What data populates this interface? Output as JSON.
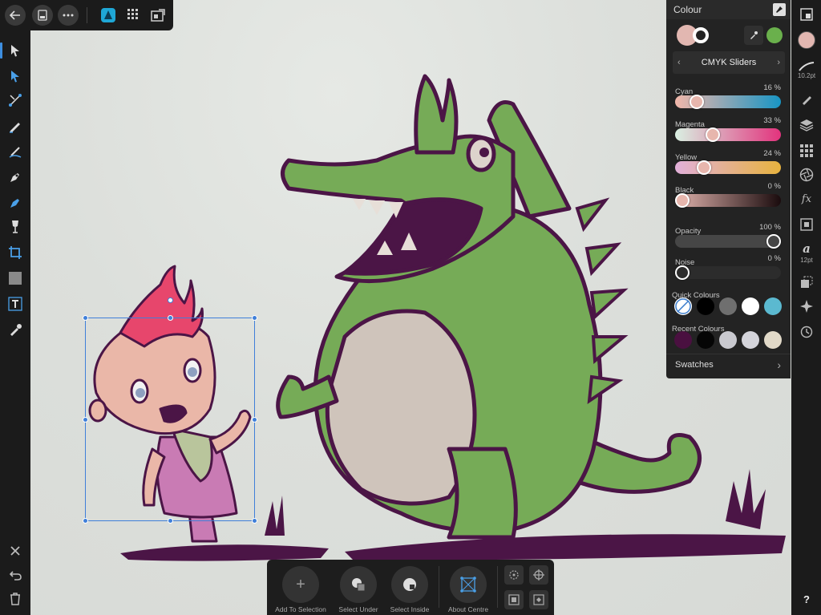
{
  "colour_panel": {
    "title": "Colour",
    "mode": "CMYK Sliders",
    "cyan": {
      "label": "Cyan",
      "value": "16 %",
      "fraction": 0.16
    },
    "magenta": {
      "label": "Magenta",
      "value": "33 %",
      "fraction": 0.33
    },
    "yellow": {
      "label": "Yellow",
      "value": "24 %",
      "fraction": 0.24
    },
    "black": {
      "label": "Black",
      "value": "0 %",
      "fraction": 0.0
    },
    "opacity": {
      "label": "Opacity",
      "value": "100 %",
      "fraction": 1.0
    },
    "noise": {
      "label": "Noise",
      "value": "0 %",
      "fraction": 0.0
    },
    "quick_colours_label": "Quick Colours",
    "recent_colours_label": "Recent Colours",
    "swatches_label": "Swatches",
    "fill_colour": "#e2b7b1",
    "secondary_colour": "#6ab04c",
    "quick_colours": [
      "none",
      "#000000",
      "#6f6f6f",
      "#ffffff",
      "#5bb9d0"
    ],
    "recent_colours": [
      "#4a1040",
      "#050505",
      "#c9c9cf",
      "#d4d4da",
      "#e1d9c8"
    ]
  },
  "right_toolbar": {
    "brush_size": "10.2pt",
    "text_size": "12pt"
  },
  "context_bar": {
    "add_to_selection": "Add To Selection",
    "select_under": "Select Under",
    "select_inside": "Select Inside",
    "about_centre": "About Centre"
  },
  "misc": {
    "help": "?"
  }
}
